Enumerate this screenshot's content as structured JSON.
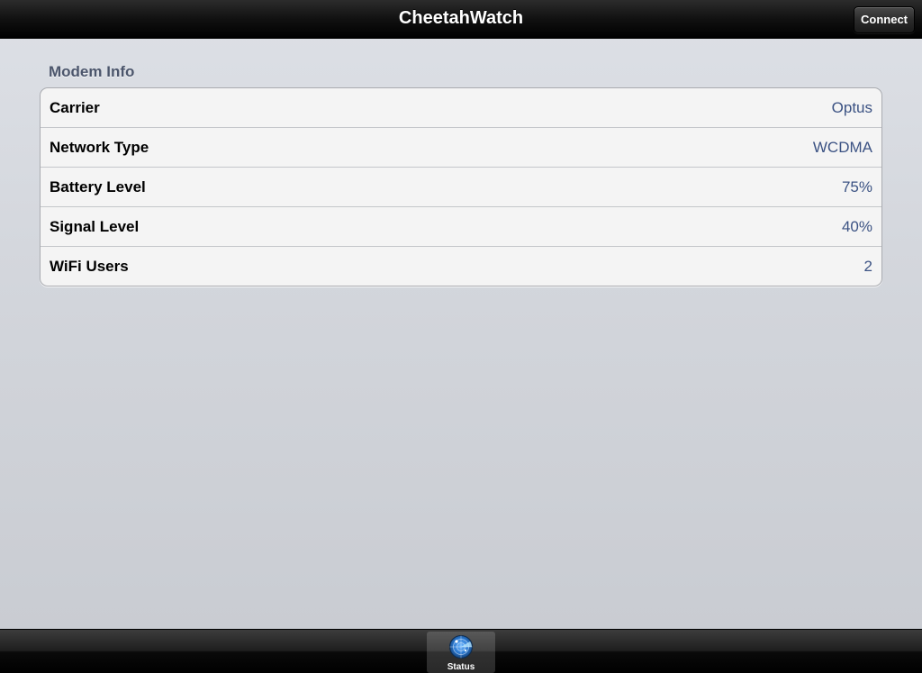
{
  "navbar": {
    "title": "CheetahWatch",
    "connect_label": "Connect"
  },
  "section": {
    "header": "Modem Info"
  },
  "modem_info": {
    "rows": [
      {
        "label": "Carrier",
        "value": "Optus"
      },
      {
        "label": "Network Type",
        "value": "WCDMA"
      },
      {
        "label": "Battery Level",
        "value": "75%"
      },
      {
        "label": "Signal Level",
        "value": "40%"
      },
      {
        "label": "WiFi Users",
        "value": "2"
      }
    ]
  },
  "tabbar": {
    "tabs": [
      {
        "label": "Status",
        "icon": "radar-icon",
        "selected": true
      }
    ]
  },
  "colors": {
    "value_text": "#3b5283",
    "section_header": "#4c566c",
    "navbar": "#000000"
  }
}
